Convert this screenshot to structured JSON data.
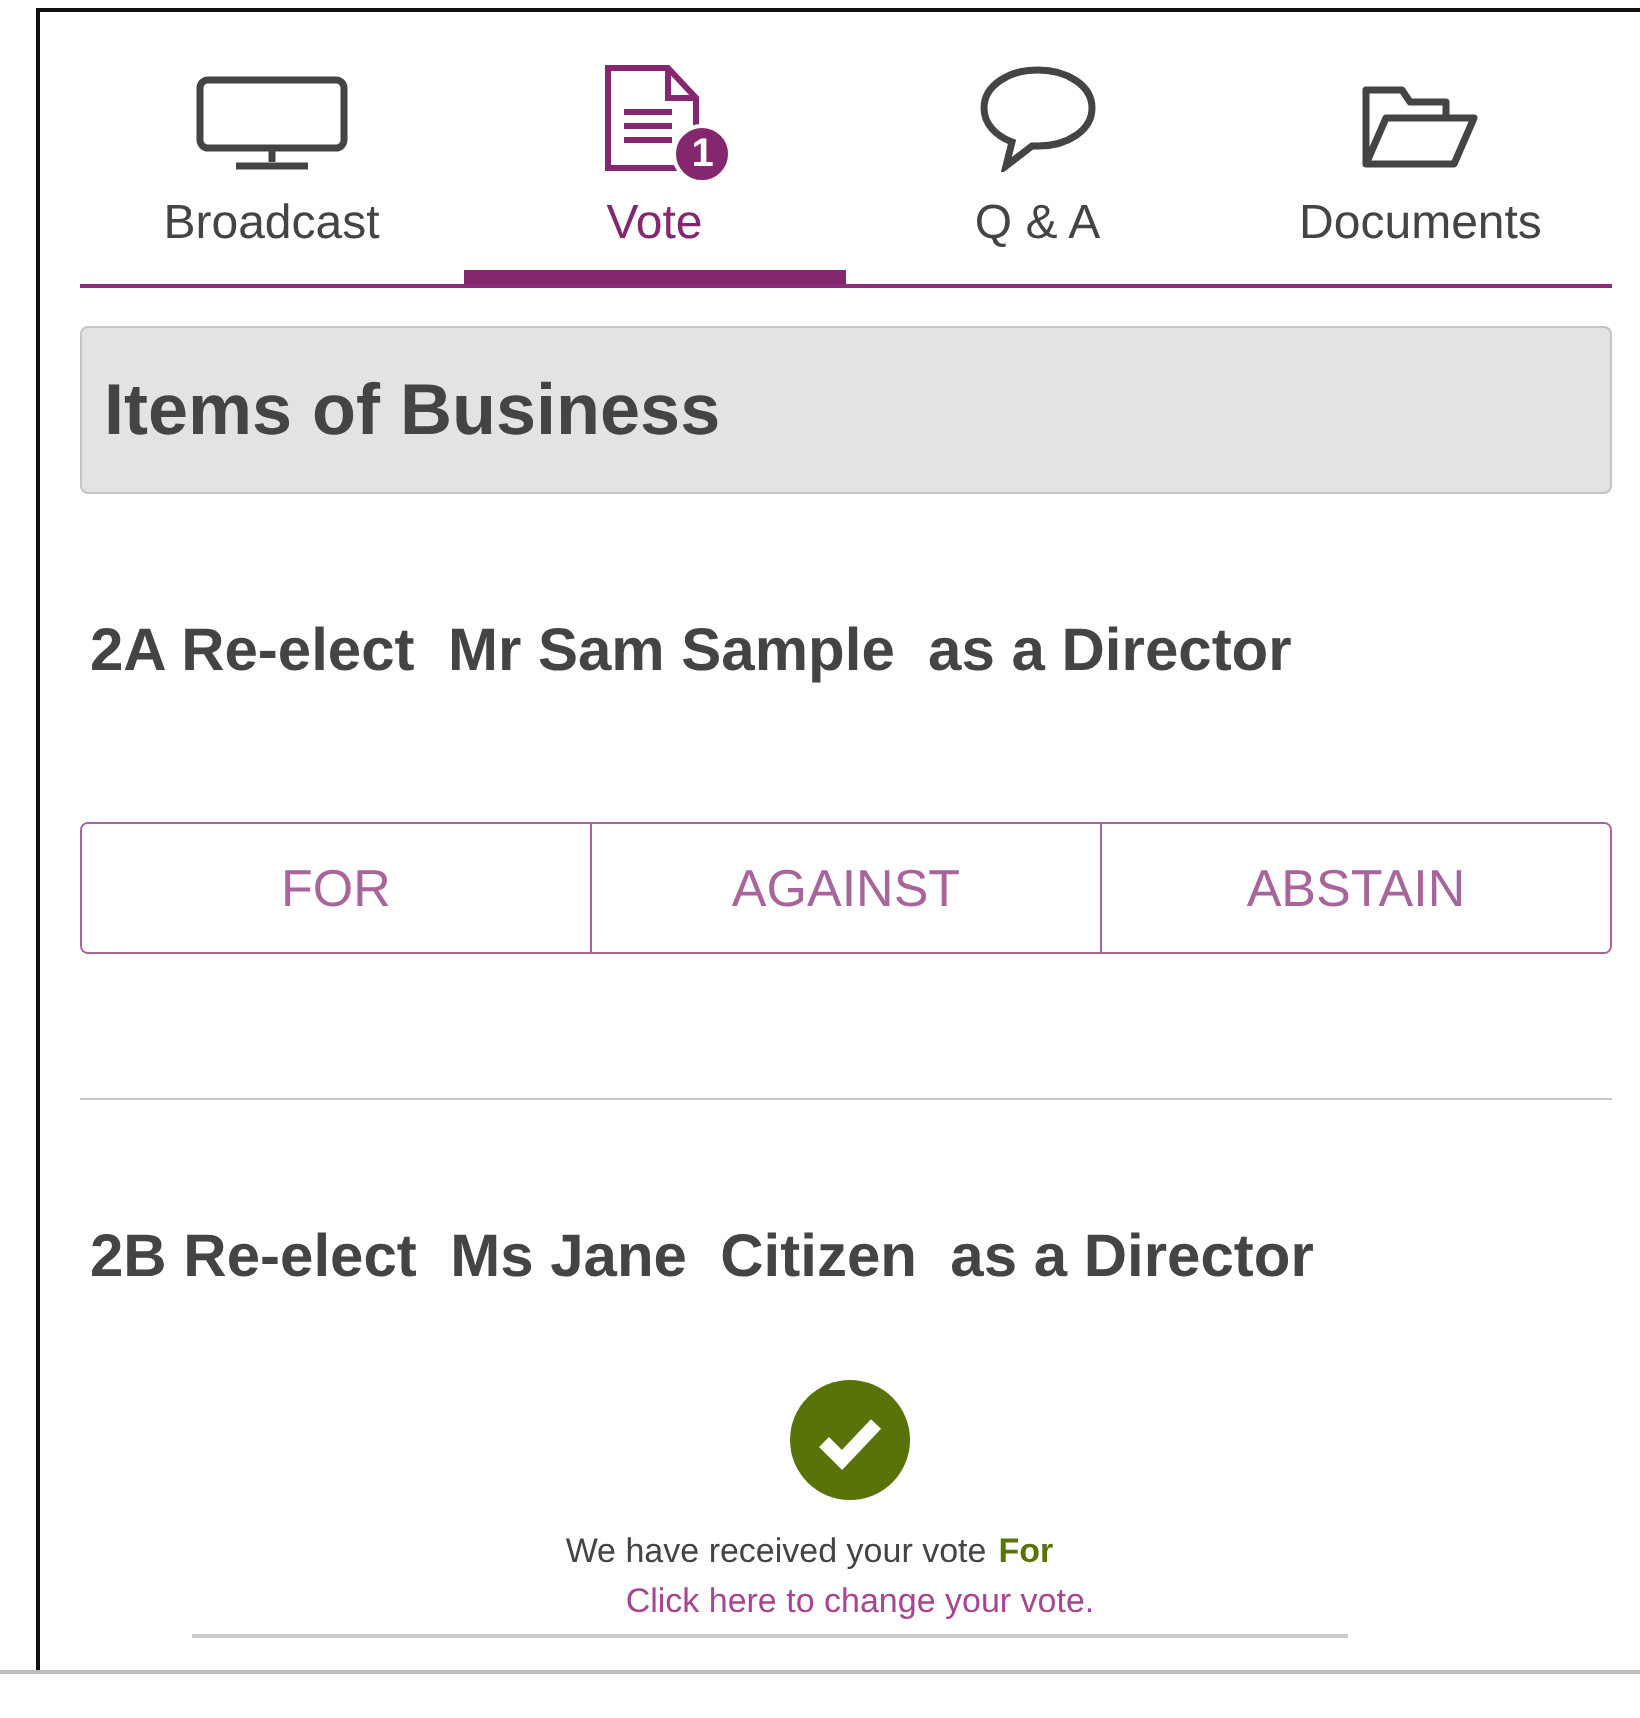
{
  "tabs": [
    {
      "label": "Broadcast",
      "selected": false
    },
    {
      "label": "Vote",
      "selected": true,
      "badge": "1"
    },
    {
      "label": "Q & A",
      "selected": false
    },
    {
      "label": "Documents",
      "selected": false
    }
  ],
  "section_title": "Items of Business",
  "items": [
    {
      "kind": "choices",
      "title": "2A Re-elect  Mr Sam Sample  as a Director",
      "choices": [
        "FOR",
        "AGAINST",
        "ABSTAIN"
      ]
    },
    {
      "kind": "voted",
      "title": "2B Re-elect  Ms Jane  Citizen  as a Director",
      "message": "We have received your vote",
      "vote": "For",
      "link": "Click here to change your vote."
    }
  ]
}
